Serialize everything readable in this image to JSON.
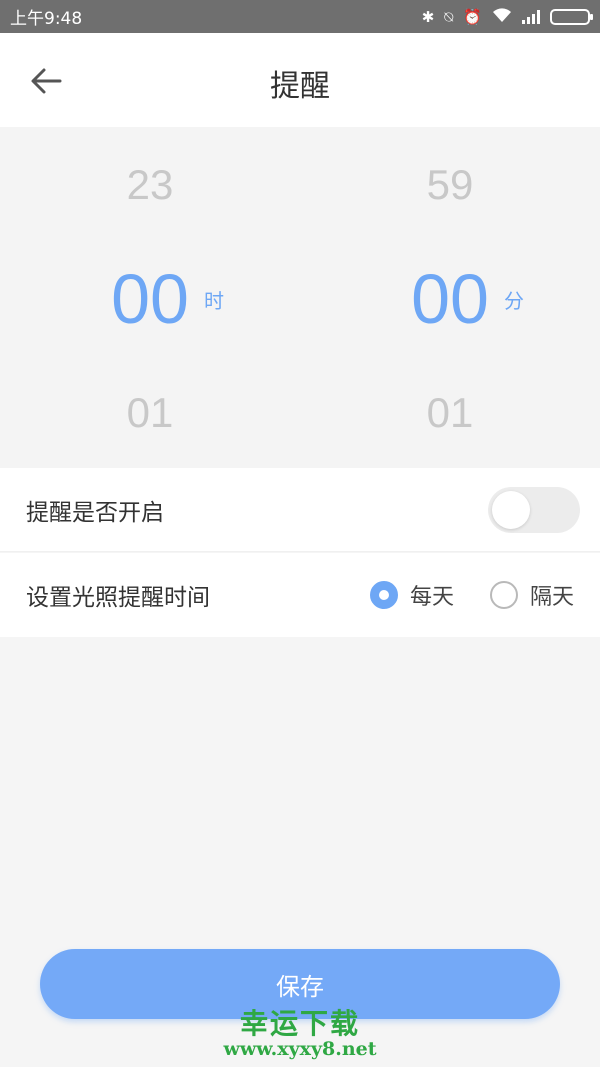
{
  "status_bar": {
    "time": "上午9:48",
    "icons": [
      "bluetooth-icon",
      "alarm-muted-icon",
      "alarm-icon",
      "wifi-icon",
      "signal-icon",
      "battery-icon"
    ]
  },
  "header": {
    "title": "提醒",
    "back_icon": "arrow-left-icon"
  },
  "time_picker": {
    "hours": {
      "above": "23",
      "selected": "00",
      "below": "01",
      "unit": "时"
    },
    "minutes": {
      "above": "59",
      "selected": "00",
      "below": "01",
      "unit": "分"
    },
    "selected_color": "#6ea7f5"
  },
  "reminder_toggle": {
    "label": "提醒是否开启",
    "enabled": false
  },
  "schedule": {
    "label": "设置光照提醒时间",
    "options": [
      {
        "label": "每天",
        "checked": true
      },
      {
        "label": "隔天",
        "checked": false
      }
    ]
  },
  "save_button": {
    "label": "保存",
    "color": "#74a9f7"
  },
  "watermark": {
    "title": "幸运下载",
    "url": "www.xyxy8.net"
  }
}
